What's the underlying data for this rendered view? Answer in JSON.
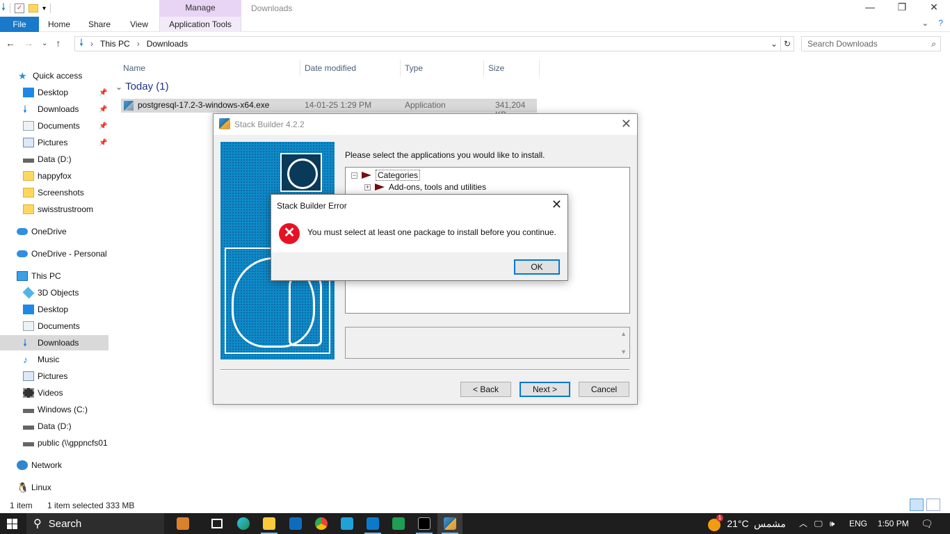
{
  "explorer": {
    "title_tab_manage": "Manage",
    "window_title": "Downloads",
    "ribbon_tabs": [
      "File",
      "Home",
      "Share",
      "View",
      "Application Tools"
    ],
    "address": {
      "path": [
        "This PC",
        "Downloads"
      ],
      "search_placeholder": "Search Downloads"
    },
    "nav_pane": [
      {
        "label": "Quick access",
        "icon": "star-icon"
      },
      {
        "label": "Desktop",
        "icon": "desktop-icon",
        "pinned": true
      },
      {
        "label": "Downloads",
        "icon": "download-icon",
        "pinned": true
      },
      {
        "label": "Documents",
        "icon": "documents-icon",
        "pinned": true
      },
      {
        "label": "Pictures",
        "icon": "pictures-icon",
        "pinned": true
      },
      {
        "label": "Data (D:)",
        "icon": "drive-icon"
      },
      {
        "label": "happyfox",
        "icon": "folder-icon"
      },
      {
        "label": "Screenshots",
        "icon": "folder-icon"
      },
      {
        "label": "swisstrustroom",
        "icon": "folder-icon"
      },
      {
        "label": "OneDrive",
        "icon": "cloud-icon"
      },
      {
        "label": "OneDrive - Personal",
        "icon": "cloud-icon"
      },
      {
        "label": "This PC",
        "icon": "pc-icon"
      },
      {
        "label": "3D Objects",
        "icon": "cube-icon"
      },
      {
        "label": "Desktop",
        "icon": "desktop-icon"
      },
      {
        "label": "Documents",
        "icon": "documents-icon"
      },
      {
        "label": "Downloads",
        "icon": "download-icon",
        "selected": true
      },
      {
        "label": "Music",
        "icon": "music-icon"
      },
      {
        "label": "Pictures",
        "icon": "pictures-icon"
      },
      {
        "label": "Videos",
        "icon": "video-icon"
      },
      {
        "label": "Windows (C:)",
        "icon": "drive-icon"
      },
      {
        "label": "Data (D:)",
        "icon": "drive-icon"
      },
      {
        "label": "public (\\\\gppncfs01",
        "icon": "network-drive-icon"
      },
      {
        "label": "Network",
        "icon": "network-icon"
      },
      {
        "label": "Linux",
        "icon": "linux-icon"
      }
    ],
    "columns": [
      "Name",
      "Date modified",
      "Type",
      "Size"
    ],
    "group": "Today (1)",
    "files": [
      {
        "name": "postgresql-17.2-3-windows-x64.exe",
        "date": "14-01-25 1:29 PM",
        "type": "Application",
        "size": "341,204 KB"
      }
    ],
    "status": {
      "count": "1 item",
      "selected": "1 item selected  333 MB"
    }
  },
  "stack_builder": {
    "title": "Stack Builder 4.2.2",
    "instruction": "Please select the applications you would like to install.",
    "tree": [
      {
        "label": "Categories",
        "expander": "−"
      },
      {
        "label": "Add-ons, tools and utilities",
        "expander": "+"
      }
    ],
    "buttons": {
      "back": "< Back",
      "next": "Next >",
      "cancel": "Cancel"
    }
  },
  "error_dialog": {
    "title": "Stack Builder Error",
    "message": "You must select at least one package to install before you continue.",
    "ok": "OK"
  },
  "taskbar": {
    "search": "Search",
    "weather": "21°C",
    "weather_text": "مشمس",
    "weather_badge": "1",
    "lang": "ENG",
    "time": "1:50 PM"
  }
}
